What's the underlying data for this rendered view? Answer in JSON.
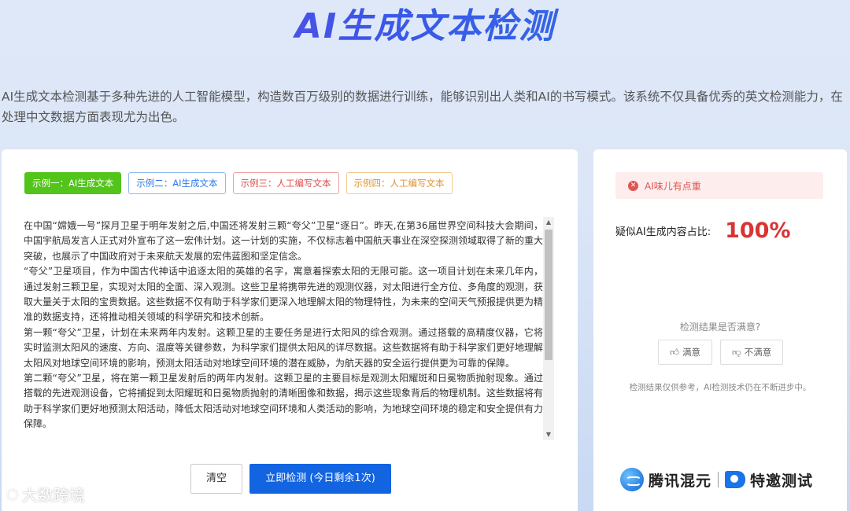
{
  "header": {
    "title": "AI生成文本检测",
    "intro": "AI生成文本检测基于多种先进的人工智能模型，构造数百万级别的数据进行训练，能够识别出人类和AI的书写模式。该系统不仅具备优秀的英文检测能力，在处理中文数据方面表现尤为出色。"
  },
  "examples": {
    "tabs": [
      {
        "label": "示例一：AI生成文本"
      },
      {
        "label": "示例二：AI生成文本"
      },
      {
        "label": "示例三：人工编写文本"
      },
      {
        "label": "示例四：人工编写文本"
      }
    ],
    "active_index": 0
  },
  "input": {
    "paragraphs": [
      "在中国“嫦娥一号”探月卫星于明年发射之后,中国还将发射三颗“夸父”卫星“逐日”。昨天,在第36届世界空间科技大会期间，中国宇航局发言人正式对外宣布了这一宏伟计划。这一计划的实施，不仅标志着中国航天事业在深空探测领域取得了新的重大突破，也展示了中国政府对于未来航天发展的宏伟蓝图和坚定信念。",
      "“夸父”卫星项目，作为中国古代神话中追逐太阳的英雄的名字，寓意着探索太阳的无限可能。这一项目计划在未来几年内，通过发射三颗卫星，实现对太阳的全面、深入观测。这些卫星将携带先进的观测仪器，对太阳进行全方位、多角度的观测，获取大量关于太阳的宝贵数据。这些数据不仅有助于科学家们更深入地理解太阳的物理特性，为未来的空间天气预报提供更为精准的数据支持，还将推动相关领域的科学研究和技术创新。",
      "第一颗“夸父”卫星，计划在未来两年内发射。这颗卫星的主要任务是进行太阳风的综合观测。通过搭载的高精度仪器，它将实时监测太阳风的速度、方向、温度等关键参数，为科学家们提供太阳风的详尽数据。这些数据将有助于科学家们更好地理解太阳风对地球空间环境的影响，预测太阳活动对地球空间环境的潜在威胁，为航天器的安全运行提供更为可靠的保障。",
      "第二颗“夸父”卫星，将在第一颗卫星发射后的两年内发射。这颗卫星的主要目标是观测太阳耀斑和日冕物质抛射现象。通过搭载的先进观测设备，它将捕捉到太阳耀斑和日冕物质抛射的清晰图像和数据，揭示这些现象背后的物理机制。这些数据将有助于科学家们更好地预测太阳活动，降低太阳活动对地球空间环境和人类活动的影响，为地球空间环境的稳定和安全提供有力保障。"
    ]
  },
  "actions": {
    "clear_label": "清空",
    "detect_label": "立即检测 (今日剩余1次)"
  },
  "result": {
    "alert_text": "AI味儿有点重",
    "ratio_label": "疑似AI生成内容占比:",
    "ratio_value": "100%",
    "feedback_question": "检测结果是否满意?",
    "satisfied_label": "满意",
    "unsatisfied_label": "不满意",
    "disclaimer": "检测结果仅供参考，AI检测技术仍在不断进步中。",
    "brand1": "腾讯混元",
    "brand2": "特邀测试"
  },
  "watermark": {
    "text": "大数跨境"
  },
  "colors": {
    "accent": "#1264e0",
    "alert_red": "#d93434",
    "active_tab_green": "#52c41a"
  }
}
